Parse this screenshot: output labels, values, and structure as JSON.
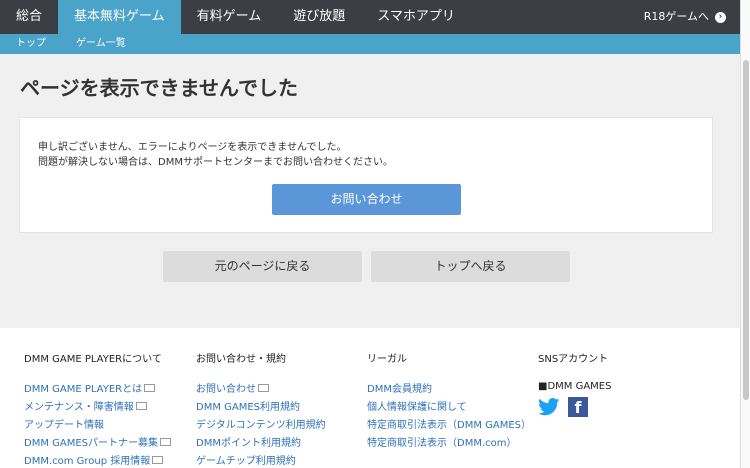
{
  "nav": {
    "tabs": [
      {
        "label": "総合"
      },
      {
        "label": "基本無料ゲーム"
      },
      {
        "label": "有料ゲーム"
      },
      {
        "label": "遊び放題"
      },
      {
        "label": "スマホアプリ"
      }
    ],
    "r18_label": "R18ゲームへ",
    "r18_arrow": "›"
  },
  "subnav": {
    "items": [
      {
        "label": "トップ"
      },
      {
        "label": "ゲーム一覧"
      }
    ]
  },
  "main": {
    "title": "ページを表示できませんでした",
    "message_line1": "申し訳ございません、エラーによりページを表示できませんでした。",
    "message_line2": "問題が解決しない場合は、DMMサポートセンターまでお問い合わせください。",
    "contact_button": "お問い合わせ",
    "back_button": "元のページに戻る",
    "top_button": "トップへ戻る"
  },
  "footer": {
    "col1": {
      "heading": "DMM GAME PLAYERについて",
      "links": [
        "DMM GAME PLAYERとは",
        "メンテナンス・障害情報",
        "アップデート情報",
        "DMM GAMESパートナー募集",
        "DMM.com Group 採用情報"
      ]
    },
    "col2": {
      "heading": "お問い合わせ・規約",
      "links": [
        "お問い合わせ",
        "DMM GAMES利用規約",
        "デジタルコンテンツ利用規約",
        "DMMポイント利用規約",
        "ゲームチップ利用規約"
      ]
    },
    "col3": {
      "heading": "リーガル",
      "links": [
        "DMM会員規約",
        "個人情報保護に関して",
        "特定商取引法表示（DMM GAMES）",
        "特定商取引法表示（DMM.com）"
      ]
    },
    "col4": {
      "heading": "SNSアカウント",
      "sns_label": "■DMM GAMES",
      "fb_glyph": "f"
    }
  },
  "colors": {
    "nav_bg": "#3b3f43",
    "accent": "#4aa3c9",
    "contact_button": "#5b96d9",
    "link": "#2d72b8"
  },
  "icons": [
    "chevron-right-icon",
    "external-window-icon",
    "twitter-icon",
    "facebook-icon"
  ]
}
